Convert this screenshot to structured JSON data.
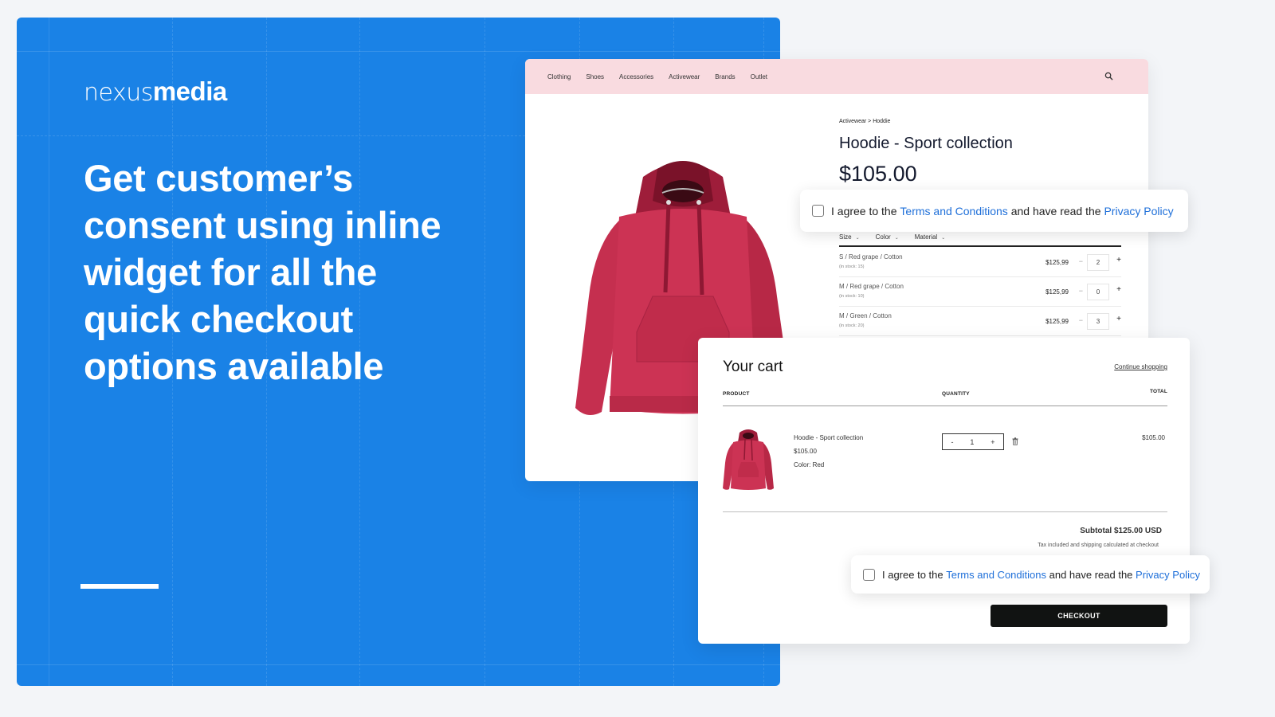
{
  "hero": {
    "logo_light": "nexus",
    "logo_bold": "media",
    "headline": "Get customer’s consent using inline widget for all the quick checkout options available",
    "background_color": "#1a82e6"
  },
  "product_page": {
    "nav": {
      "items": [
        "Clothing",
        "Shoes",
        "Accessories",
        "Activewear",
        "Brands",
        "Outlet"
      ],
      "search_icon": "search-icon",
      "background_color": "#f9dbe0"
    },
    "breadcrumb": "Activewear > Hoddie",
    "title": "Hoodie - Sport collection",
    "price": "$105.00",
    "filters": [
      {
        "label": "Size"
      },
      {
        "label": "Color"
      },
      {
        "label": "Material"
      }
    ],
    "variants": [
      {
        "name": "S / Red grape / Cotton",
        "stock": "(in stock: 15)",
        "price": "$125,99",
        "qty": "2"
      },
      {
        "name": "M / Red grape / Cotton",
        "stock": "(in stock: 10)",
        "price": "$125,99",
        "qty": "0"
      },
      {
        "name": "M / Green / Cotton",
        "stock": "(in stock: 20)",
        "price": "$125,99",
        "qty": "3"
      }
    ]
  },
  "consent_widget": {
    "prefix": "I agree to the",
    "terms_link": "Terms and Conditions",
    "middle": "and have read the",
    "privacy_link": "Privacy Policy",
    "link_color": "#1e6fd9",
    "checked": false
  },
  "cart": {
    "title": "Your cart",
    "continue_label": "Continue shopping",
    "columns": {
      "product": "PRODUCT",
      "quantity": "QUANTITY",
      "total": "TOTAL"
    },
    "items": [
      {
        "name": "Hoodie - Sport collection",
        "price": "$105.00",
        "color": "Color: Red",
        "qty": "1",
        "total": "$105.00"
      }
    ],
    "stepper": {
      "minus": "-",
      "plus": "+"
    },
    "subtotal": "Subtotal $125.00 USD",
    "tax_note": "Tax included and shipping calculated at checkout",
    "checkout_label": "CHECKOUT"
  }
}
